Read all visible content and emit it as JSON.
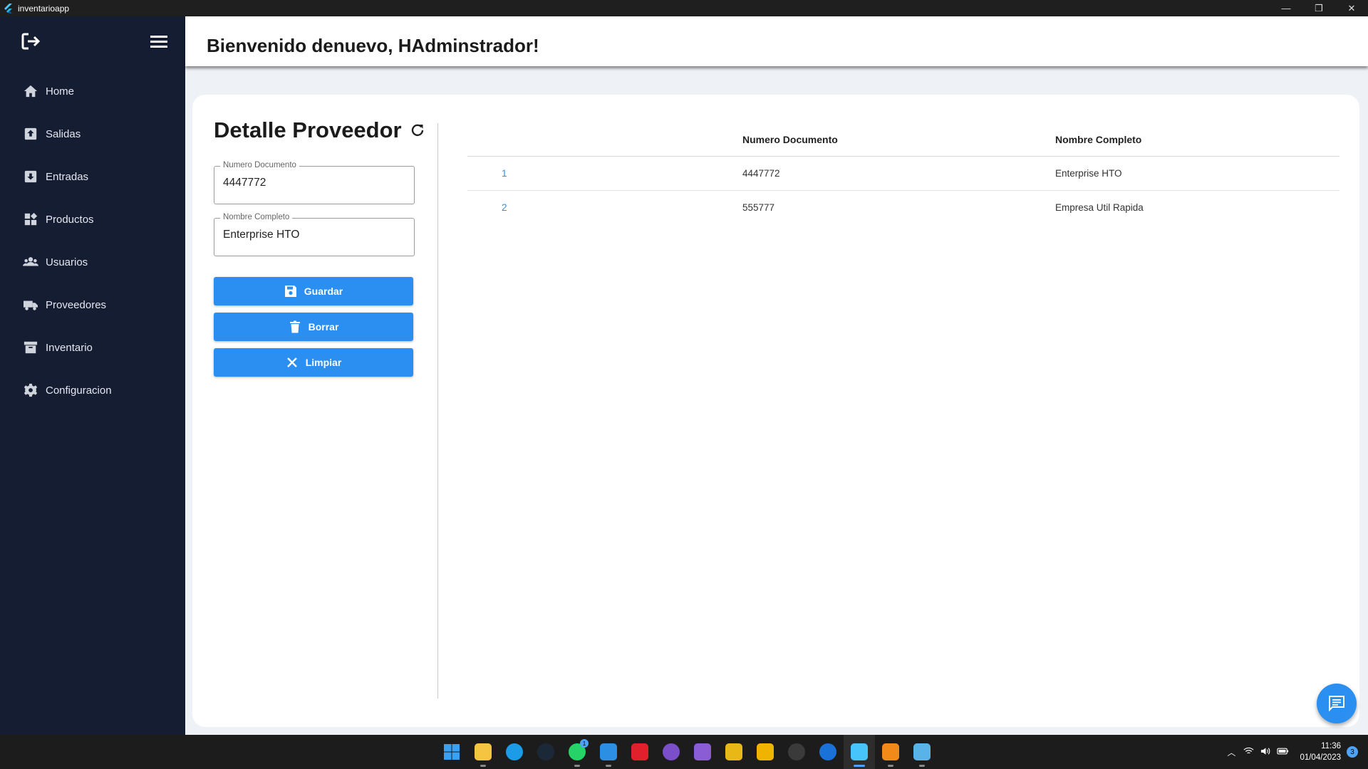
{
  "window": {
    "title": "inventarioapp",
    "controls": [
      "—",
      "❐",
      "✕"
    ]
  },
  "sidebar": {
    "items": [
      {
        "label": "Home",
        "icon": "home-icon"
      },
      {
        "label": "Salidas",
        "icon": "outbox-icon"
      },
      {
        "label": "Entradas",
        "icon": "inbox-icon"
      },
      {
        "label": "Productos",
        "icon": "widgets-icon"
      },
      {
        "label": "Usuarios",
        "icon": "users-icon"
      },
      {
        "label": "Proveedores",
        "icon": "truck-icon"
      },
      {
        "label": "Inventario",
        "icon": "archive-icon"
      },
      {
        "label": "Configuracion",
        "icon": "gear-icon"
      }
    ]
  },
  "header": {
    "title": "Bienvenido denuevo, HAdminstrador!"
  },
  "form": {
    "title": "Detalle Proveedor",
    "numero_documento": {
      "label": "Numero Documento",
      "value": "4447772"
    },
    "nombre_completo": {
      "label": "Nombre Completo",
      "value": "Enterprise HTO"
    },
    "buttons": {
      "guardar": "Guardar",
      "borrar": "Borrar",
      "limpiar": "Limpiar"
    }
  },
  "table": {
    "columns": [
      "",
      "Numero Documento",
      "Nombre Completo"
    ],
    "rows": [
      {
        "id": "1",
        "numero": "4447772",
        "nombre": "Enterprise HTO"
      },
      {
        "id": "2",
        "numero": "555777",
        "nombre": "Empresa Util Rapida"
      }
    ]
  },
  "taskbar": {
    "apps": [
      "start",
      "file-explorer",
      "edge",
      "steam",
      "whatsapp",
      "vscode",
      "app-red",
      "github-desktop",
      "visual-studio",
      "app-yellow",
      "app-yellow-2",
      "obs",
      "teamviewer",
      "flutter-app",
      "sublime-text",
      "app-terminal"
    ],
    "whatsapp_badge": "1",
    "clock_time": "11:36",
    "clock_date": "01/04/2023",
    "notifications": "3",
    "colors": {
      "start": "#3aa0f2",
      "file-explorer": "#f5c542",
      "edge": "#1c9be6",
      "steam": "#1b2838",
      "whatsapp": "#25d366",
      "vscode": "#2c8fe4",
      "app-red": "#e0202a",
      "github-desktop": "#7b4fc9",
      "visual-studio": "#8a5cd6",
      "app-yellow": "#e7b816",
      "app-yellow-2": "#f0b400",
      "obs": "#3a3a3a",
      "teamviewer": "#1a72d9",
      "flutter-app": "#47c5fb",
      "sublime-text": "#f28a1a",
      "app-terminal": "#5ab3e8"
    }
  },
  "colors": {
    "sidebar": "#151d33",
    "primary": "#2a8ff0",
    "background": "#eef1f6"
  }
}
